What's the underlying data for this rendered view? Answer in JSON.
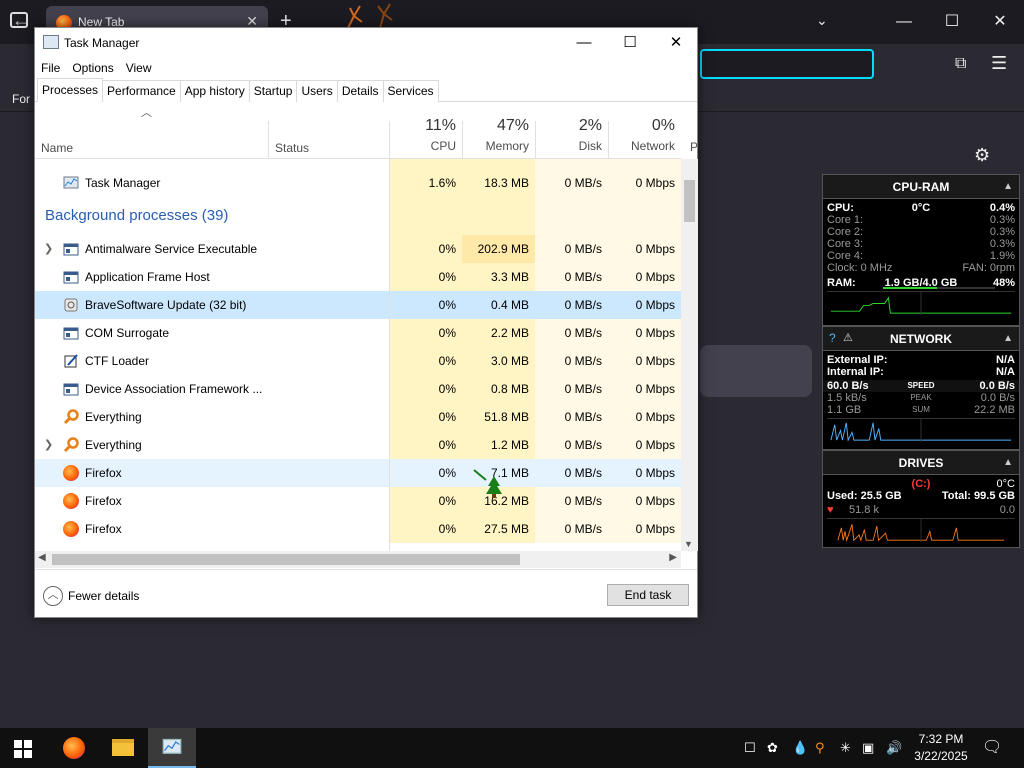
{
  "browser": {
    "tab_title": "New Tab",
    "tab_close": "✕",
    "new_tab": "+",
    "bookmarks_text": "For",
    "win_controls": [
      "—",
      "☐",
      "✕"
    ]
  },
  "task_manager": {
    "title": "Task Manager",
    "controls": {
      "minimize": "—",
      "maximize": "☐",
      "close": "✕"
    },
    "menu": [
      "File",
      "Options",
      "View"
    ],
    "tabs": [
      "Processes",
      "Performance",
      "App history",
      "Startup",
      "Users",
      "Details",
      "Services"
    ],
    "active_tab": "Processes",
    "headers": {
      "name": "Name",
      "status": "Status",
      "cpu_pct": "11%",
      "cpu": "CPU",
      "mem_pct": "47%",
      "mem": "Memory",
      "disk_pct": "2%",
      "disk": "Disk",
      "net_pct": "0%",
      "net": "Network",
      "power": "P"
    },
    "app_row": {
      "name": "Task Manager",
      "cpu": "1.6%",
      "mem": "18.3 MB",
      "disk": "0 MB/s",
      "net": "0 Mbps"
    },
    "background_header": "Background processes (39)",
    "processes": [
      {
        "name": "Antimalware Service Executable",
        "cpu": "0%",
        "mem": "202.9 MB",
        "disk": "0 MB/s",
        "net": "0 Mbps",
        "expand": true
      },
      {
        "name": "Application Frame Host",
        "cpu": "0%",
        "mem": "3.3 MB",
        "disk": "0 MB/s",
        "net": "0 Mbps"
      },
      {
        "name": "BraveSoftware Update (32 bit)",
        "cpu": "0%",
        "mem": "0.4 MB",
        "disk": "0 MB/s",
        "net": "0 Mbps",
        "selected": true
      },
      {
        "name": "COM Surrogate",
        "cpu": "0%",
        "mem": "2.2 MB",
        "disk": "0 MB/s",
        "net": "0 Mbps"
      },
      {
        "name": "CTF Loader",
        "cpu": "0%",
        "mem": "3.0 MB",
        "disk": "0 MB/s",
        "net": "0 Mbps"
      },
      {
        "name": "Device Association Framework ...",
        "cpu": "0%",
        "mem": "0.8 MB",
        "disk": "0 MB/s",
        "net": "0 Mbps"
      },
      {
        "name": "Everything",
        "cpu": "0%",
        "mem": "51.8 MB",
        "disk": "0 MB/s",
        "net": "0 Mbps"
      },
      {
        "name": "Everything",
        "cpu": "0%",
        "mem": "1.2 MB",
        "disk": "0 MB/s",
        "net": "0 Mbps",
        "expand": true
      },
      {
        "name": "Firefox",
        "cpu": "0%",
        "mem": "7.1 MB",
        "disk": "0 MB/s",
        "net": "0 Mbps",
        "hover": true
      },
      {
        "name": "Firefox",
        "cpu": "0%",
        "mem": "16.2 MB",
        "disk": "0 MB/s",
        "net": "0 Mbps"
      },
      {
        "name": "Firefox",
        "cpu": "0%",
        "mem": "27.5 MB",
        "disk": "0 MB/s",
        "net": "0 Mbps"
      }
    ],
    "fewer_details": "Fewer details",
    "end_task": "End task"
  },
  "widgets": {
    "cpu_ram": {
      "title": "CPU-RAM",
      "cpu_label": "CPU:",
      "cpu_temp": "0°C",
      "cpu_pct": "0.4%",
      "cores": [
        {
          "label": "Core 1:",
          "value": "0.3%"
        },
        {
          "label": "Core 2:",
          "value": "0.3%"
        },
        {
          "label": "Core 3:",
          "value": "0.3%"
        },
        {
          "label": "Core 4:",
          "value": "1.9%"
        }
      ],
      "clock": "Clock: 0 MHz",
      "fan": "FAN: 0rpm",
      "ram_label": "RAM:",
      "ram_value": "1.9 GB/4.0 GB",
      "ram_pct": "48%",
      "ram_fraction": 0.48
    },
    "network": {
      "title": "NETWORK",
      "ext_ip_label": "External IP:",
      "ext_ip": "N/A",
      "int_ip_label": "Internal IP:",
      "int_ip": "N/A",
      "speed_left": "60.0 B/s",
      "speed_label": "SPEED",
      "speed_right": "0.0 B/s",
      "peak_left": "1.5 kB/s",
      "peak_label": "PEAK",
      "peak_right": "0.0 B/s",
      "sum_left": "1.1 GB",
      "sum_label": "SUM",
      "sum_right": "22.2 MB"
    },
    "drives": {
      "title": "DRIVES",
      "drive": "(C:)",
      "temp": "0°C",
      "used": "Used: 25.5 GB",
      "total": "Total: 99.5 GB",
      "read": "51.8 k",
      "write": "0.0"
    }
  },
  "taskbar": {
    "time": "7:32 PM",
    "date": "3/22/2025"
  }
}
